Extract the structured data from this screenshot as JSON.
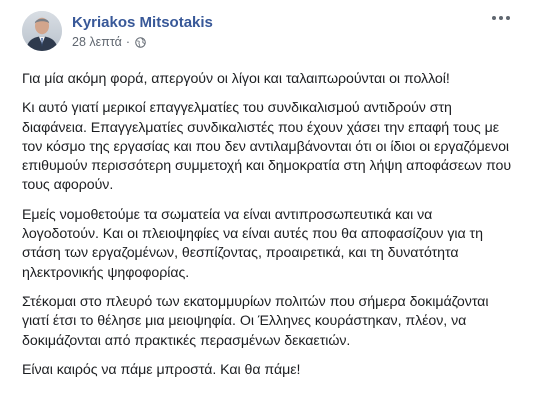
{
  "post": {
    "author": "Kyriakos Mitsotakis",
    "timestamp": "28 λεπτά",
    "separator": "·",
    "privacy_icon": "globe-icon",
    "more_icon": "ellipsis-icon",
    "paragraphs": [
      "Για μία ακόμη φορά, απεργούν οι λίγοι και ταλαιπωρούνται οι πολλοί!",
      "Κι αυτό γιατί μερικοί επαγγελματίες του συνδικαλισμού αντιδρούν στη διαφάνεια. Επαγγελματίες συνδικαλιστές που έχουν χάσει την επαφή τους με τον κόσμο της εργασίας και που δεν αντιλαμβάνονται ότι οι ίδιοι οι εργαζόμενοι επιθυμούν περισσότερη συμμετοχή και δημοκρατία στη λήψη αποφάσεων που τους αφορούν.",
      "Εμείς νομοθετούμε τα σωματεία να είναι αντιπροσωπευτικά και να λογοδοτούν. Και οι πλειοψηφίες να είναι αυτές που θα αποφασίζουν για τη στάση των εργαζομένων, θεσπίζοντας, προαιρετικά, και τη δυνατότητα ηλεκτρονικής ψηφοφορίας.",
      "Στέκομαι στο πλευρό των εκατομμυρίων πολιτών που σήμερα δοκιμάζονται γιατί έτσι το θέλησε μια μειοψηφία. Οι Έλληνες κουράστηκαν, πλέον, να δοκιμάζονται από πρακτικές περασμένων δεκαετιών.",
      "Είναι καιρός να πάμε μπροστά. Και θα πάμε!"
    ]
  },
  "colors": {
    "author": "#385898",
    "meta": "#606770",
    "text": "#1c1e21",
    "background": "#ffffff"
  }
}
